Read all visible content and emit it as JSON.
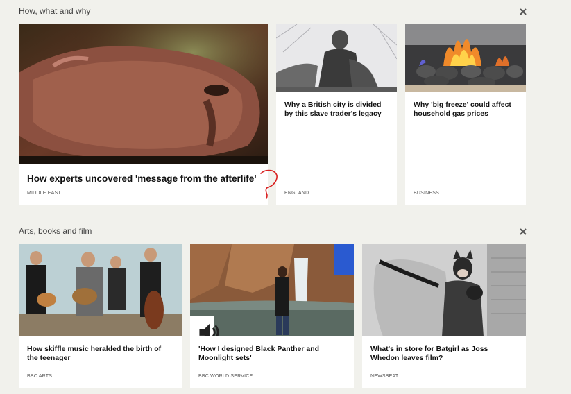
{
  "sections": [
    {
      "title": "How, what and why",
      "close_label": "Close",
      "cards": [
        {
          "headline": "How experts uncovered 'message from the afterlife'",
          "tag": "MIDDLE EAST"
        },
        {
          "headline": "Why a British city is divided by this slave trader's legacy",
          "tag": "ENGLAND"
        },
        {
          "headline": "Why 'big freeze' could affect household gas prices",
          "tag": "BUSINESS"
        }
      ]
    },
    {
      "title": "Arts, books and film",
      "close_label": "Close",
      "cards": [
        {
          "headline": "How skiffle music heralded the birth of the teenager",
          "tag": "BBC ARTS"
        },
        {
          "headline": "'How I designed Black Panther and Moonlight sets'",
          "tag": "BBC WORLD SERVICE"
        },
        {
          "headline": "What's in store for Batgirl as Joss Whedon leaves film?",
          "tag": "NEWSBEAT"
        }
      ]
    }
  ],
  "icons": {
    "close": "close-icon",
    "audio": "speaker-icon"
  },
  "colors": {
    "background": "#f1f1ec",
    "card": "#ffffff",
    "annotation": "#d92020"
  }
}
